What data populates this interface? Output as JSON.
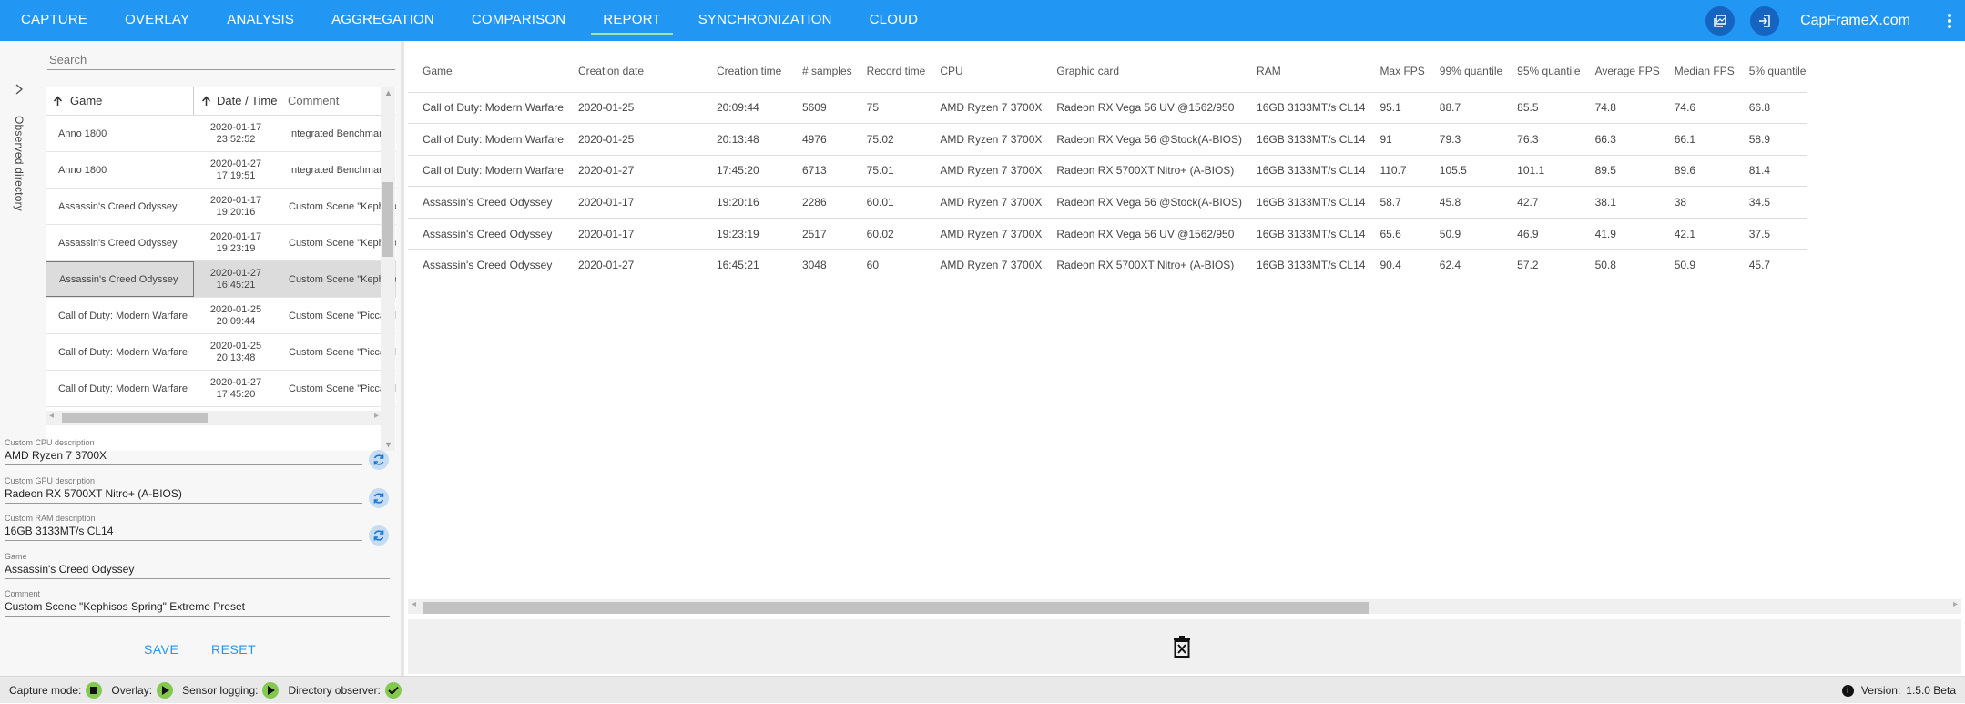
{
  "nav": {
    "items": [
      "CAPTURE",
      "OVERLAY",
      "ANALYSIS",
      "AGGREGATION",
      "COMPARISON",
      "REPORT",
      "SYNCHRONIZATION",
      "CLOUD"
    ],
    "active": "REPORT",
    "brand": "CapFrameX.com"
  },
  "sidebar": {
    "observed_directory_label": "Observed directory",
    "search_placeholder": "Search",
    "columns": {
      "game": "Game",
      "datetime": "Date / Time",
      "comment": "Comment"
    },
    "records": [
      {
        "game": "Anno 1800",
        "date": "2020-01-17",
        "time": "23:52:52",
        "comment": "Integrated Benchmark"
      },
      {
        "game": "Anno 1800",
        "date": "2020-01-27",
        "time": "17:19:51",
        "comment": "Integrated Benchmark"
      },
      {
        "game": "Assassin's Creed Odyssey",
        "date": "2020-01-17",
        "time": "19:20:16",
        "comment": "Custom Scene \"Kephisos Spring\""
      },
      {
        "game": "Assassin's Creed Odyssey",
        "date": "2020-01-17",
        "time": "19:23:19",
        "comment": "Custom Scene \"Kephisos Spring\""
      },
      {
        "game": "Assassin's Creed Odyssey",
        "date": "2020-01-27",
        "time": "16:45:21",
        "comment": "Custom Scene \"Kephisos Spring\""
      },
      {
        "game": "Call of Duty: Modern Warfare",
        "date": "2020-01-25",
        "time": "20:09:44",
        "comment": "Custom Scene \"Piccadilly\""
      },
      {
        "game": "Call of Duty: Modern Warfare",
        "date": "2020-01-25",
        "time": "20:13:48",
        "comment": "Custom Scene \"Piccadilly\""
      },
      {
        "game": "Call of Duty: Modern Warfare",
        "date": "2020-01-27",
        "time": "17:45:20",
        "comment": "Custom Scene \"Piccadilly\""
      }
    ],
    "selected_index": 4
  },
  "details": {
    "cpu_label": "Custom CPU description",
    "cpu_value": "AMD Ryzen 7 3700X",
    "gpu_label": "Custom GPU description",
    "gpu_value": "Radeon RX 5700XT Nitro+ (A-BIOS)",
    "ram_label": "Custom RAM description",
    "ram_value": "16GB 3133MT/s CL14",
    "game_label": "Game",
    "game_value": "Assassin's Creed Odyssey",
    "comment_label": "Comment",
    "comment_value": "Custom Scene \"Kephisos Spring\" Extreme Preset",
    "save_label": "SAVE",
    "reset_label": "RESET"
  },
  "report": {
    "columns": [
      "Game",
      "Creation date",
      "Creation time",
      "# samples",
      "Record time",
      "CPU",
      "Graphic card",
      "RAM",
      "Max FPS",
      "99% quantile",
      "95% quantile",
      "Average FPS",
      "Median FPS",
      "5% quantile"
    ],
    "rows": [
      [
        "Call of Duty: Modern Warfare",
        "2020-01-25",
        "20:09:44",
        "5609",
        "75",
        "AMD Ryzen 7 3700X",
        "Radeon RX Vega 56 UV @1562/950",
        "16GB 3133MT/s CL14",
        "95.1",
        "88.7",
        "85.5",
        "74.8",
        "74.6",
        "66.8"
      ],
      [
        "Call of Duty: Modern Warfare",
        "2020-01-25",
        "20:13:48",
        "4976",
        "75.02",
        "AMD Ryzen 7 3700X",
        "Radeon RX Vega 56 @Stock(A-BIOS)",
        "16GB 3133MT/s CL14",
        "91",
        "79.3",
        "76.3",
        "66.3",
        "66.1",
        "58.9"
      ],
      [
        "Call of Duty: Modern Warfare",
        "2020-01-27",
        "17:45:20",
        "6713",
        "75.01",
        "AMD Ryzen 7 3700X",
        "Radeon RX 5700XT Nitro+ (A-BIOS)",
        "16GB 3133MT/s CL14",
        "110.7",
        "105.5",
        "101.1",
        "89.5",
        "89.6",
        "81.4"
      ],
      [
        "Assassin's Creed Odyssey",
        "2020-01-17",
        "19:20:16",
        "2286",
        "60.01",
        "AMD Ryzen 7 3700X",
        "Radeon RX Vega 56 @Stock(A-BIOS)",
        "16GB 3133MT/s CL14",
        "58.7",
        "45.8",
        "42.7",
        "38.1",
        "38",
        "34.5"
      ],
      [
        "Assassin's Creed Odyssey",
        "2020-01-17",
        "19:23:19",
        "2517",
        "60.02",
        "AMD Ryzen 7 3700X",
        "Radeon RX Vega 56 UV @1562/950",
        "16GB 3133MT/s CL14",
        "65.6",
        "50.9",
        "46.9",
        "41.9",
        "42.1",
        "37.5"
      ],
      [
        "Assassin's Creed Odyssey",
        "2020-01-27",
        "16:45:21",
        "3048",
        "60",
        "AMD Ryzen 7 3700X",
        "Radeon RX 5700XT Nitro+ (A-BIOS)",
        "16GB 3133MT/s CL14",
        "90.4",
        "62.4",
        "57.2",
        "50.8",
        "50.9",
        "45.7"
      ]
    ]
  },
  "status": {
    "capture_mode": "Capture mode:",
    "overlay": "Overlay:",
    "sensor_logging": "Sensor logging:",
    "directory_observer": "Directory observer:",
    "version_label": "Version:",
    "version_value": "1.5.0 Beta"
  },
  "icons": {
    "accent": "#2196f3",
    "indicator_green": "#84c94f",
    "refresh": "refresh-icon",
    "delete": "delete-records-icon"
  }
}
